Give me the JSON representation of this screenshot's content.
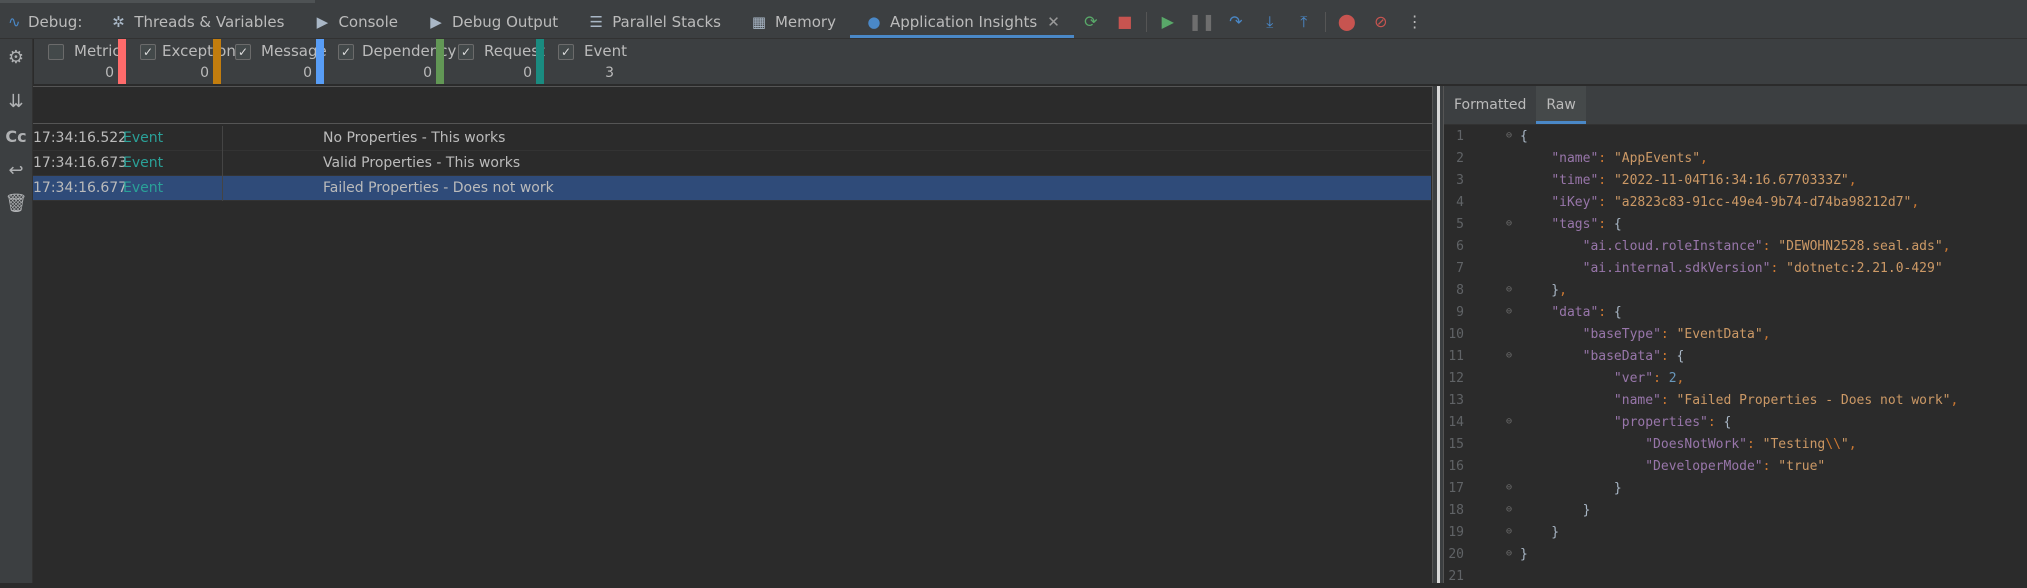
{
  "toolbar": {
    "label": "Debug:",
    "tabs": [
      {
        "id": "threads",
        "label": "Threads & Variables",
        "icon": "threads-icon"
      },
      {
        "id": "console",
        "label": "Console",
        "icon": "console-icon"
      },
      {
        "id": "debug_output",
        "label": "Debug Output",
        "icon": "output-icon"
      },
      {
        "id": "parallel",
        "label": "Parallel Stacks",
        "icon": "parallel-stacks-icon"
      },
      {
        "id": "memory",
        "label": "Memory",
        "icon": "memory-icon"
      },
      {
        "id": "appinsights",
        "label": "Application Insights",
        "icon": "lightbulb-icon",
        "active": true
      }
    ],
    "close_glyph": "✕"
  },
  "filters": [
    {
      "label": "Metric",
      "checked": false,
      "count": "0",
      "color": "#ff6b6b"
    },
    {
      "label": "Exception",
      "checked": true,
      "count": "0",
      "color": "#c27d0e"
    },
    {
      "label": "Message",
      "checked": true,
      "count": "0",
      "color": "#589df6"
    },
    {
      "label": "Dependency",
      "checked": true,
      "count": "0",
      "color": "#629755"
    },
    {
      "label": "Request",
      "checked": true,
      "count": "0",
      "color": "#1a8b80"
    },
    {
      "label": "Event",
      "checked": true,
      "count": "3",
      "color": "#3c3f41"
    }
  ],
  "search": {
    "value": "",
    "placeholder": ""
  },
  "events": [
    {
      "time": "17:34:16.522",
      "type": "Event",
      "name": "No Properties - This works",
      "selected": false
    },
    {
      "time": "17:34:16.673",
      "type": "Event",
      "name": "Valid Properties - This works",
      "selected": false
    },
    {
      "time": "17:34:16.677",
      "type": "Event",
      "name": "Failed Properties - Does not work",
      "selected": true
    }
  ],
  "detail_tabs": {
    "formatted": "Formatted",
    "raw": "Raw"
  },
  "json_lines": [
    "{",
    "    \"name\": \"AppEvents\",",
    "    \"time\": \"2022-11-04T16:34:16.6770333Z\",",
    "    \"iKey\": \"a2823c83-91cc-49e4-9b74-d74ba98212d7\",",
    "    \"tags\": {",
    "        \"ai.cloud.roleInstance\": \"DEWOHN2528.seal.ads\",",
    "        \"ai.internal.sdkVersion\": \"dotnetc:2.21.0-429\"",
    "    },",
    "    \"data\": {",
    "        \"baseType\": \"EventData\",",
    "        \"baseData\": {",
    "            \"ver\": 2,",
    "            \"name\": \"Failed Properties - Does not work\",",
    "            \"properties\": {",
    "                \"DoesNotWork\": \"Testing\\\\\",",
    "                \"DeveloperMode\": \"true\"",
    "            }",
    "        }",
    "    }",
    "}",
    ""
  ],
  "colors": {
    "accent": "#4a88c7",
    "selection": "#2f4b79",
    "event_type": "#2aa198"
  }
}
